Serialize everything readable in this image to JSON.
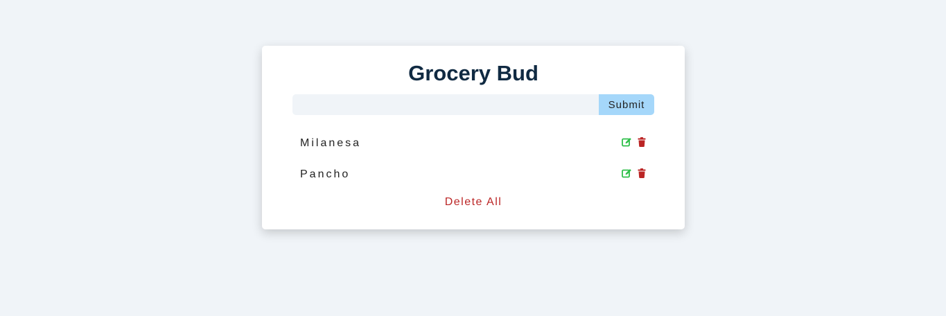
{
  "app": {
    "title": "Grocery Bud"
  },
  "form": {
    "input_value": "",
    "input_placeholder": "",
    "submit_label": "Submit"
  },
  "items": [
    {
      "name": "Milanesa",
      "edit_icon": "edit-icon",
      "delete_icon": "trash-icon"
    },
    {
      "name": "Pancho",
      "edit_icon": "edit-icon",
      "delete_icon": "trash-icon"
    }
  ],
  "clear_label": "Delete All",
  "colors": {
    "background": "#f0f4f8",
    "title": "#102a42",
    "submit_bg": "#a5d7fa",
    "edit": "#2fbf4a",
    "delete": "#bb2525"
  }
}
